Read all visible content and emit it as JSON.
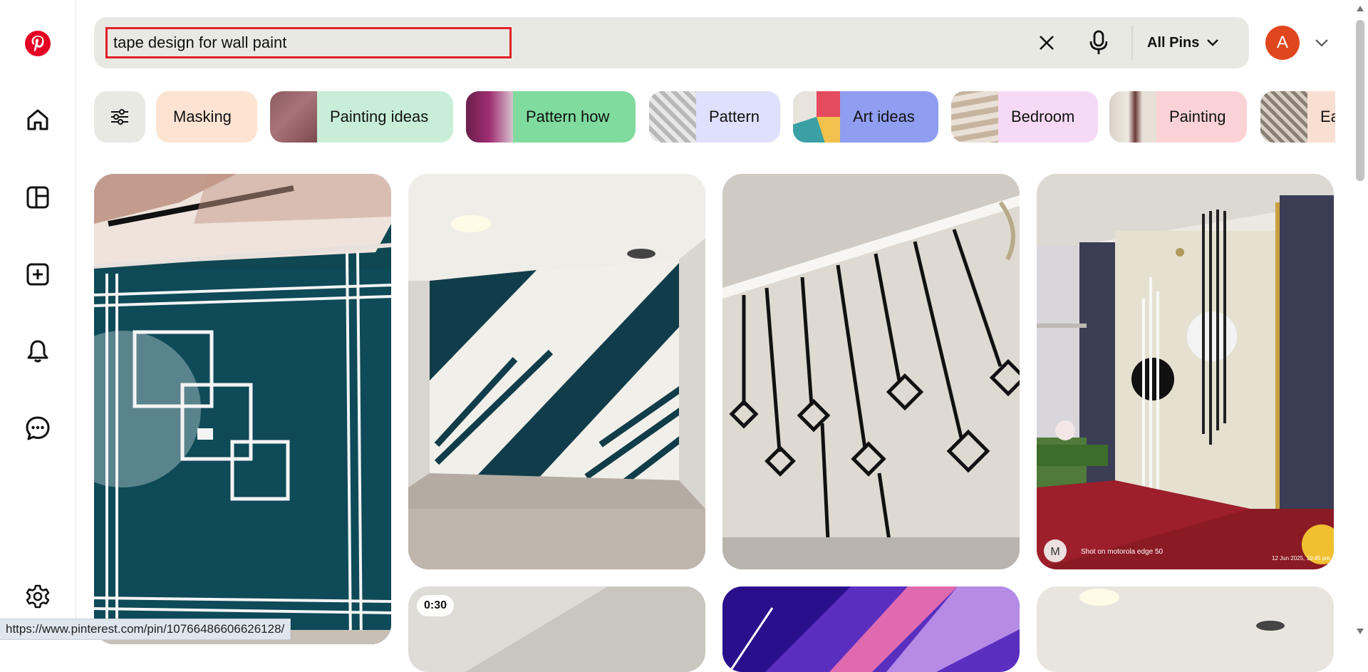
{
  "search": {
    "query": "tape design for wall paint",
    "scope_label": "All Pins"
  },
  "account": {
    "avatar_letter": "A",
    "avatar_color": "#e0461e"
  },
  "brand": {
    "color": "#e60023"
  },
  "nav": [
    {
      "name": "home",
      "icon": "home-icon"
    },
    {
      "name": "boards",
      "icon": "boards-icon"
    },
    {
      "name": "create",
      "icon": "create-icon"
    },
    {
      "name": "notifications",
      "icon": "bell-icon"
    },
    {
      "name": "messages",
      "icon": "chat-icon"
    },
    {
      "name": "settings",
      "icon": "gear-icon"
    }
  ],
  "chips": [
    {
      "label": "Masking",
      "bg": "#fce3d2"
    },
    {
      "label": "Painting ideas",
      "bg": "#c8eed8"
    },
    {
      "label": "Pattern how",
      "bg": "#7fdb9e"
    },
    {
      "label": "Pattern",
      "bg": "#dfe0fb"
    },
    {
      "label": "Art ideas",
      "bg": "#8f9ef0"
    },
    {
      "label": "Bedroom",
      "bg": "#f6d9f5"
    },
    {
      "label": "Painting",
      "bg": "#fbd3d6"
    },
    {
      "label": "Ea",
      "bg": "#f9dfd2"
    }
  ],
  "pins": [
    {
      "name": "pin-teal-square-tape"
    },
    {
      "name": "pin-diagonal-stripes"
    },
    {
      "name": "pin-hanging-diamonds"
    },
    {
      "name": "pin-circles-lines",
      "watermark": "Shot on motorola edge 50",
      "date": "12 Jun 2025, 10:45 pm"
    },
    {
      "name": "pin-video",
      "duration": "0:30"
    },
    {
      "name": "pin-purple-ceiling"
    },
    {
      "name": "pin-ceiling-light"
    }
  ],
  "status_url": "https://www.pinterest.com/pin/10766486606626128/"
}
